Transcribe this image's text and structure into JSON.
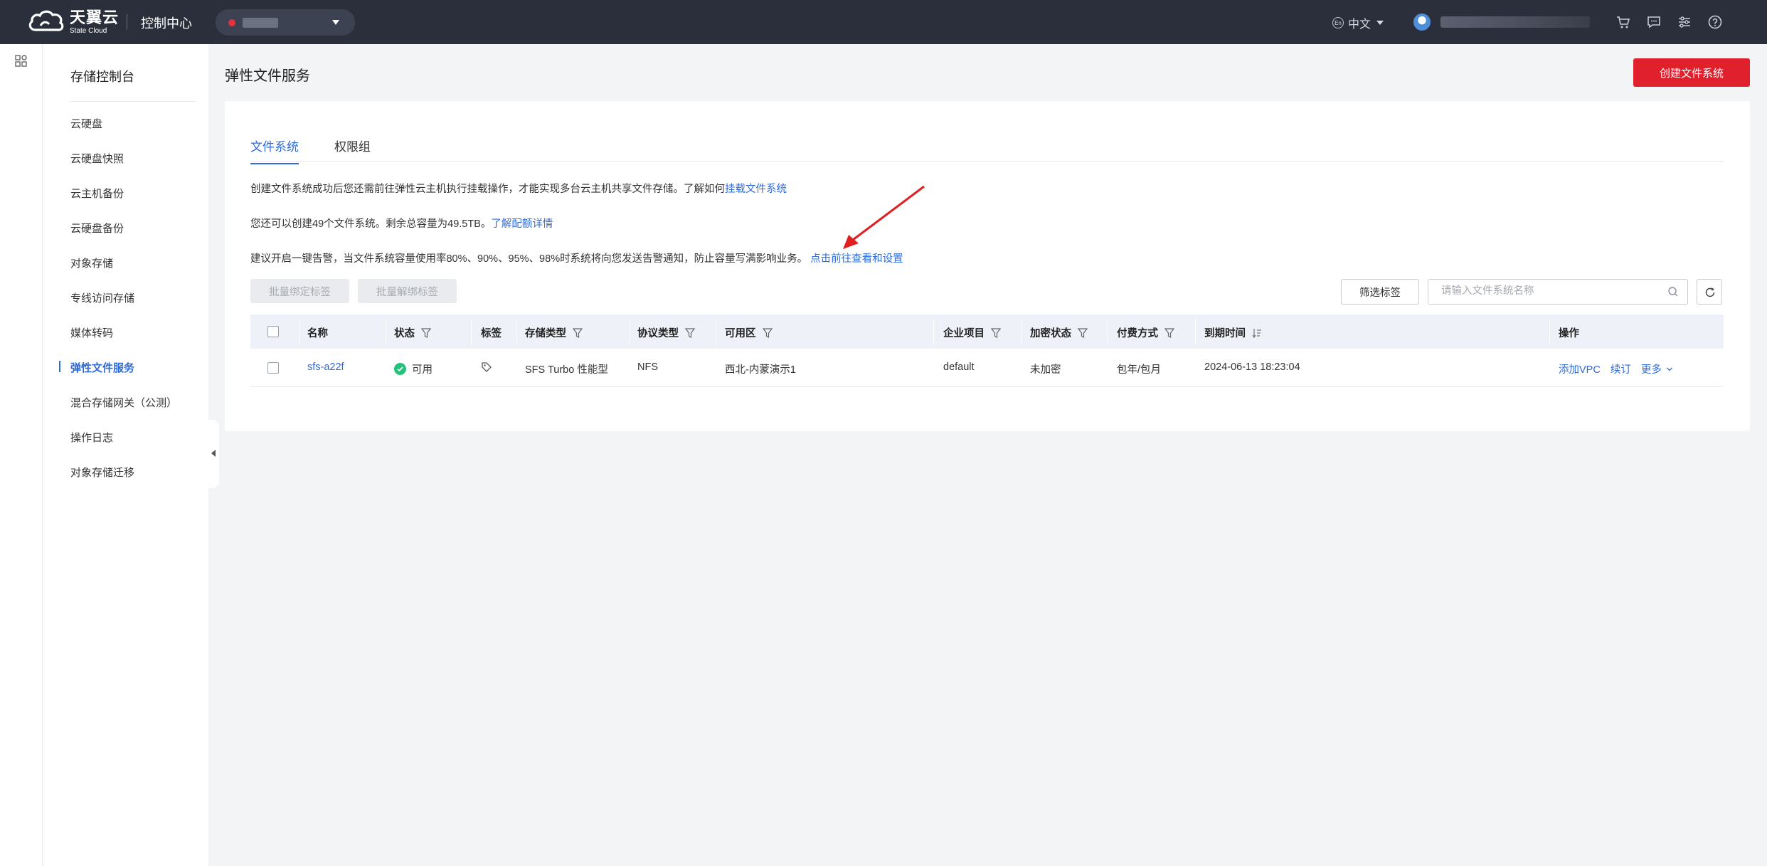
{
  "topbar": {
    "logo_cn": "天翼云",
    "logo_en": "State Cloud",
    "console_title": "控制中心",
    "language": "中文"
  },
  "sidebar": {
    "title": "存储控制台",
    "items": [
      {
        "label": "云硬盘"
      },
      {
        "label": "云硬盘快照"
      },
      {
        "label": "云主机备份"
      },
      {
        "label": "云硬盘备份"
      },
      {
        "label": "对象存储"
      },
      {
        "label": "专线访问存储"
      },
      {
        "label": "媒体转码"
      },
      {
        "label": "弹性文件服务",
        "active": true
      },
      {
        "label": "混合存储网关（公测）"
      },
      {
        "label": "操作日志"
      },
      {
        "label": "对象存储迁移"
      }
    ]
  },
  "main": {
    "page_title": "弹性文件服务",
    "create_button": "创建文件系统",
    "tabs": [
      {
        "label": "文件系统",
        "active": true
      },
      {
        "label": "权限组"
      }
    ],
    "info": {
      "line1_text": "创建文件系统成功后您还需前往弹性云主机执行挂载操作，才能实现多台云主机共享文件存储。了解如何",
      "line1_link": "挂载文件系统",
      "line2_text": "您还可以创建49个文件系统。剩余总容量为49.5TB。",
      "line2_link": "了解配额详情",
      "line3_text": "建议开启一键告警，当文件系统容量使用率80%、90%、95%、98%时系统将向您发送告警通知，防止容量写满影响业务。",
      "line3_link": "点击前往查看和设置"
    },
    "toolbar": {
      "bind_tags": "批量绑定标签",
      "unbind_tags": "批量解绑标签",
      "filter_tags": "筛选标签",
      "search_placeholder": "请输入文件系统名称"
    },
    "table": {
      "columns": {
        "name": "名称",
        "status": "状态",
        "tag": "标签",
        "storage_type": "存储类型",
        "protocol": "协议类型",
        "zone": "可用区",
        "project": "企业项目",
        "encryption": "加密状态",
        "billing": "付费方式",
        "expire": "到期时间",
        "actions": "操作"
      },
      "rows": [
        {
          "name": "sfs-a22f",
          "status": "可用",
          "storage_type": "SFS Turbo 性能型",
          "protocol": "NFS",
          "zone": "西北-内蒙演示1",
          "project": "default",
          "encryption": "未加密",
          "billing": "包年/包月",
          "expire": "2024-06-13 18:23:04",
          "action_add_vpc": "添加VPC",
          "action_renew": "续订",
          "action_more": "更多"
        }
      ]
    }
  },
  "colors": {
    "accent": "#2f6bd9",
    "brand_red": "#e0202d",
    "topbar": "#2b2f3b",
    "status_ok": "#27c27a"
  }
}
